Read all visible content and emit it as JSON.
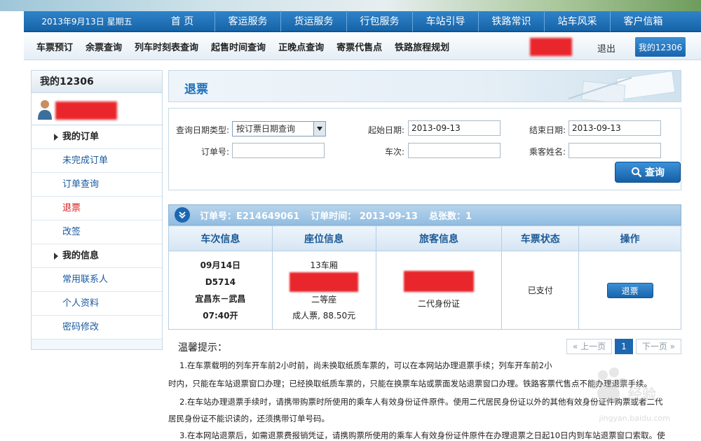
{
  "topnav": {
    "date": "2013年9月13日 星期五",
    "items": [
      "首 页",
      "客运服务",
      "货运服务",
      "行包服务",
      "车站引导",
      "铁路常识",
      "站车风采",
      "客户信箱"
    ]
  },
  "subnav": {
    "items": [
      "车票预订",
      "余票查询",
      "列车时刻表查询",
      "起售时间查询",
      "正晚点查询",
      "寄票代售点",
      "铁路旅程规划"
    ],
    "logout": "退出",
    "my12306": "我的12306"
  },
  "sidebar": {
    "title": "我的12306",
    "group_orders": "我的订单",
    "links_orders": [
      "未完成订单",
      "订单查询",
      "退票",
      "改签"
    ],
    "group_info": "我的信息",
    "links_info": [
      "常用联系人",
      "个人资料",
      "密码修改"
    ]
  },
  "main": {
    "title": "退票"
  },
  "search": {
    "date_type_label": "查询日期类型:",
    "date_type_value": "按订票日期查询",
    "start_label": "起始日期:",
    "start_value": "2013-09-13",
    "end_label": "结束日期:",
    "end_value": "2013-09-13",
    "order_no_label": "订单号:",
    "train_label": "车次:",
    "passenger_label": "乘客姓名:",
    "search_button": "查询"
  },
  "order": {
    "order_no": "订单号：E214649061",
    "order_time": "订单时间：  2013-09-13",
    "total": "总张数：1",
    "headers": [
      "车次信息",
      "座位信息",
      "旅客信息",
      "车票状态",
      "操作"
    ],
    "train_date": "09月14日",
    "train_no": "D5714",
    "route": "宜昌东－武昌",
    "depart": "07:40开",
    "car": "13车厢",
    "seat_class": "二等座",
    "ticket": "成人票, 88.50元",
    "id_type": "二代身份证",
    "status": "已支付",
    "action": "退票"
  },
  "tips": {
    "heading": "温馨提示：",
    "pager": {
      "prev": "« 上一页",
      "current": "1",
      "next": "下一页 »"
    },
    "lines": [
      "1.在车票载明的列车开车前2小时前，尚未换取纸质车票的，可以在本网站办理退票手续；列车开车前2小",
      "时内，只能在车站退票窗口办理；已经换取纸质车票的，只能在换票车站或票面发站退票窗口办理。铁路客票代售点不能办理退票手续。",
      "2.在车站办理退票手续时，请携带购票时所使用的乘车人有效身份证件原件。使用二代居民身份证以外的其他有效身份证件购票或者二代",
      "居民身份证不能识读的，还须携带订单号码。",
      "3.在本网站退票后，如需退票费报销凭证，请携购票所使用的乘车人有效身份证件原件在办理退票之日起10日内到车站退票窗口索取。使"
    ]
  },
  "watermark": {
    "text": "jingyan.baidu.com"
  }
}
